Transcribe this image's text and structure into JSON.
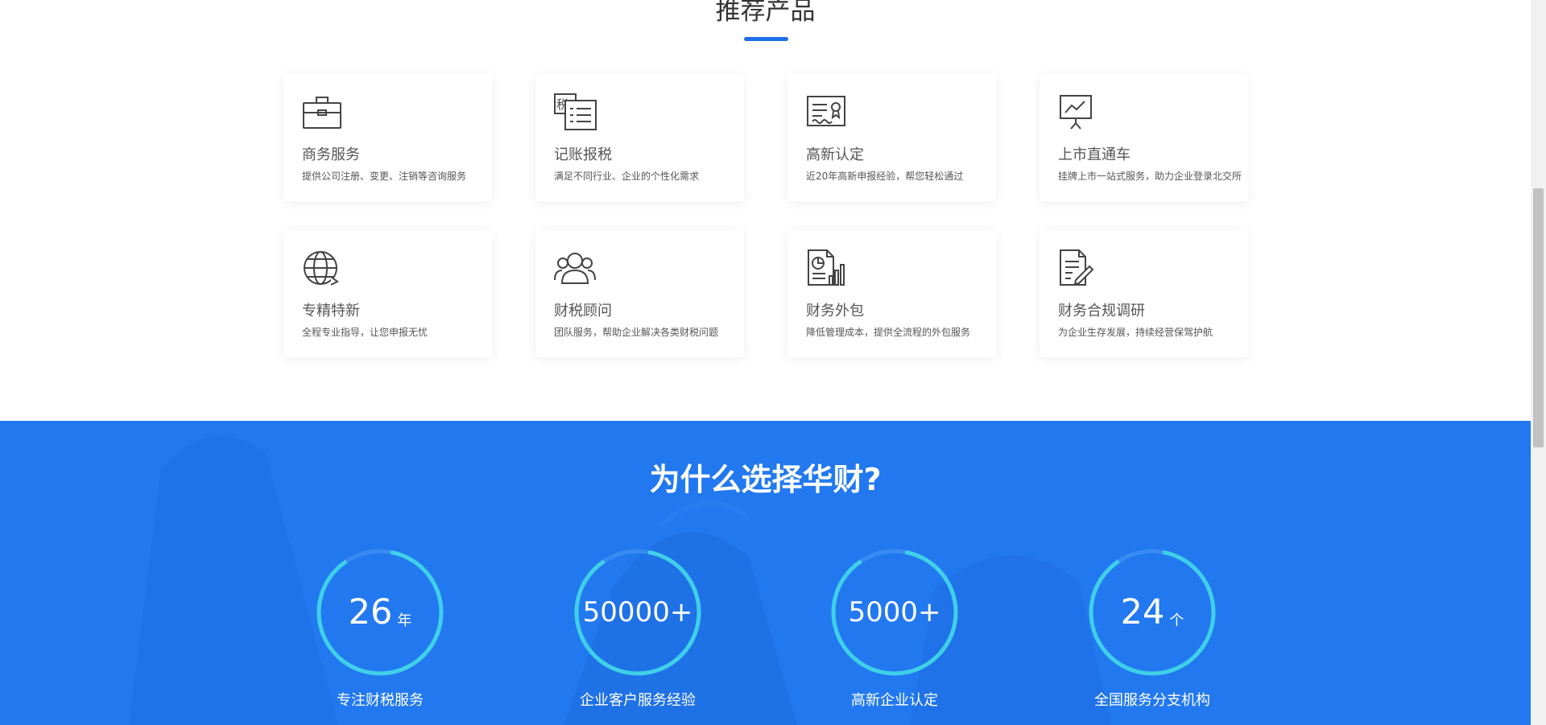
{
  "products": {
    "title": "推荐产品",
    "items": [
      {
        "icon": "briefcase-icon",
        "title": "商务服务",
        "desc": "提供公司注册、变更、注销等咨询服务"
      },
      {
        "icon": "tax-document-icon",
        "title": "记账报税",
        "desc": "满足不同行业、企业的个性化需求"
      },
      {
        "icon": "certificate-icon",
        "title": "高新认定",
        "desc": "近20年高新申报经验，帮您轻松通过"
      },
      {
        "icon": "presentation-chart-icon",
        "title": "上市直通车",
        "desc": "挂牌上市一站式服务，助力企业登录北交所"
      },
      {
        "icon": "globe-icon",
        "title": "专精特新",
        "desc": "全程专业指导，让您申报无忧"
      },
      {
        "icon": "users-icon",
        "title": "财税顾问",
        "desc": "团队服务，帮助企业解决各类财税问题"
      },
      {
        "icon": "report-chart-icon",
        "title": "财务外包",
        "desc": "降低管理成本，提供全流程的外包服务"
      },
      {
        "icon": "document-edit-icon",
        "title": "财务合规调研",
        "desc": "为企业生存发展，持续经营保驾护航"
      }
    ]
  },
  "why": {
    "title": "为什么选择华财?",
    "stats": [
      {
        "number": "26",
        "unit": "年",
        "label": "专注财税服务"
      },
      {
        "number": "50000+",
        "unit": "",
        "label": "企业客户服务经验"
      },
      {
        "number": "5000+",
        "unit": "",
        "label": "高新企业认定"
      },
      {
        "number": "24",
        "unit": "个",
        "label": "全国服务分支机构"
      }
    ]
  },
  "colors": {
    "accent": "#1f6fe8",
    "section_bg": "#2279ef",
    "ring": "#3fd0e8"
  }
}
